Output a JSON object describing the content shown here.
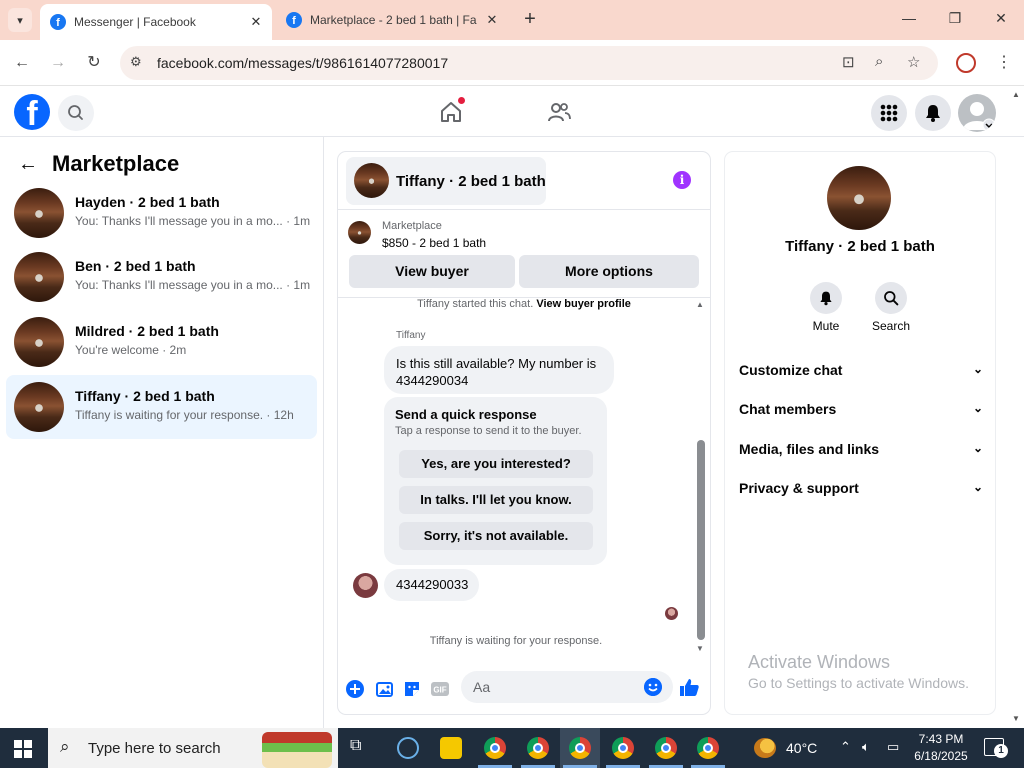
{
  "browser": {
    "tabs": [
      {
        "title": "Messenger | Facebook",
        "active": true
      },
      {
        "title": "Marketplace - 2 bed 1 bath | Fa",
        "active": false
      }
    ],
    "url": "facebook.com/messages/t/9861614077280017"
  },
  "fb_nav": {
    "logo_letter": "f",
    "home_notification": true
  },
  "left": {
    "title": "Marketplace",
    "conversations": [
      {
        "title": "Hayden · 2 bed 1 bath",
        "preview": "You: Thanks I'll message you in a mo... · 1m",
        "selected": false
      },
      {
        "title": "Ben · 2 bed 1 bath",
        "preview": "You: Thanks I'll message you in a mo... · 1m",
        "selected": false
      },
      {
        "title": "Mildred · 2 bed 1 bath",
        "preview": "You're welcome · 2m",
        "selected": false
      },
      {
        "title": "Tiffany · 2 bed 1 bath",
        "preview": "Tiffany is waiting for your response. · 12h",
        "selected": true
      }
    ]
  },
  "chat": {
    "header_title": "Tiffany · 2 bed 1 bath",
    "marketplace_label": "Marketplace",
    "listing_price": "$850 - 2 bed 1 bath",
    "view_buyer_label": "View buyer",
    "more_options_label": "More options",
    "started_text": "Tiffany started this chat.",
    "view_buyer_profile": "View buyer profile",
    "sender_name": "Tiffany",
    "message_1": "Is this still available? My number is 4344290034",
    "quick_title": "Send a quick response",
    "quick_sub": "Tap a response to send it to the buyer.",
    "quick_responses": [
      "Yes, are you interested?",
      "In talks. I'll let you know.",
      "Sorry, it's not available."
    ],
    "message_2": "4344290033",
    "waiting_text": "Tiffany is waiting for your response.",
    "composer_placeholder": "Aa"
  },
  "right": {
    "title": "Tiffany · 2 bed 1 bath",
    "actions": [
      {
        "label": "Mute",
        "icon": "bell-icon"
      },
      {
        "label": "Search",
        "icon": "search-icon"
      }
    ],
    "sections": [
      "Customize chat",
      "Chat members",
      "Media, files and links",
      "Privacy & support"
    ]
  },
  "watermark": {
    "line1": "Activate Windows",
    "line2": "Go to Settings to activate Windows."
  },
  "taskbar": {
    "search_placeholder": "Type here to search",
    "temperature": "40°C",
    "time": "7:43 PM",
    "date": "6/18/2025",
    "notification_count": "1"
  },
  "colors": {
    "accent": "#0866ff",
    "info": "#a033ff",
    "selected_bg": "#ebf5ff",
    "tabbar": "#f9d8cd"
  }
}
